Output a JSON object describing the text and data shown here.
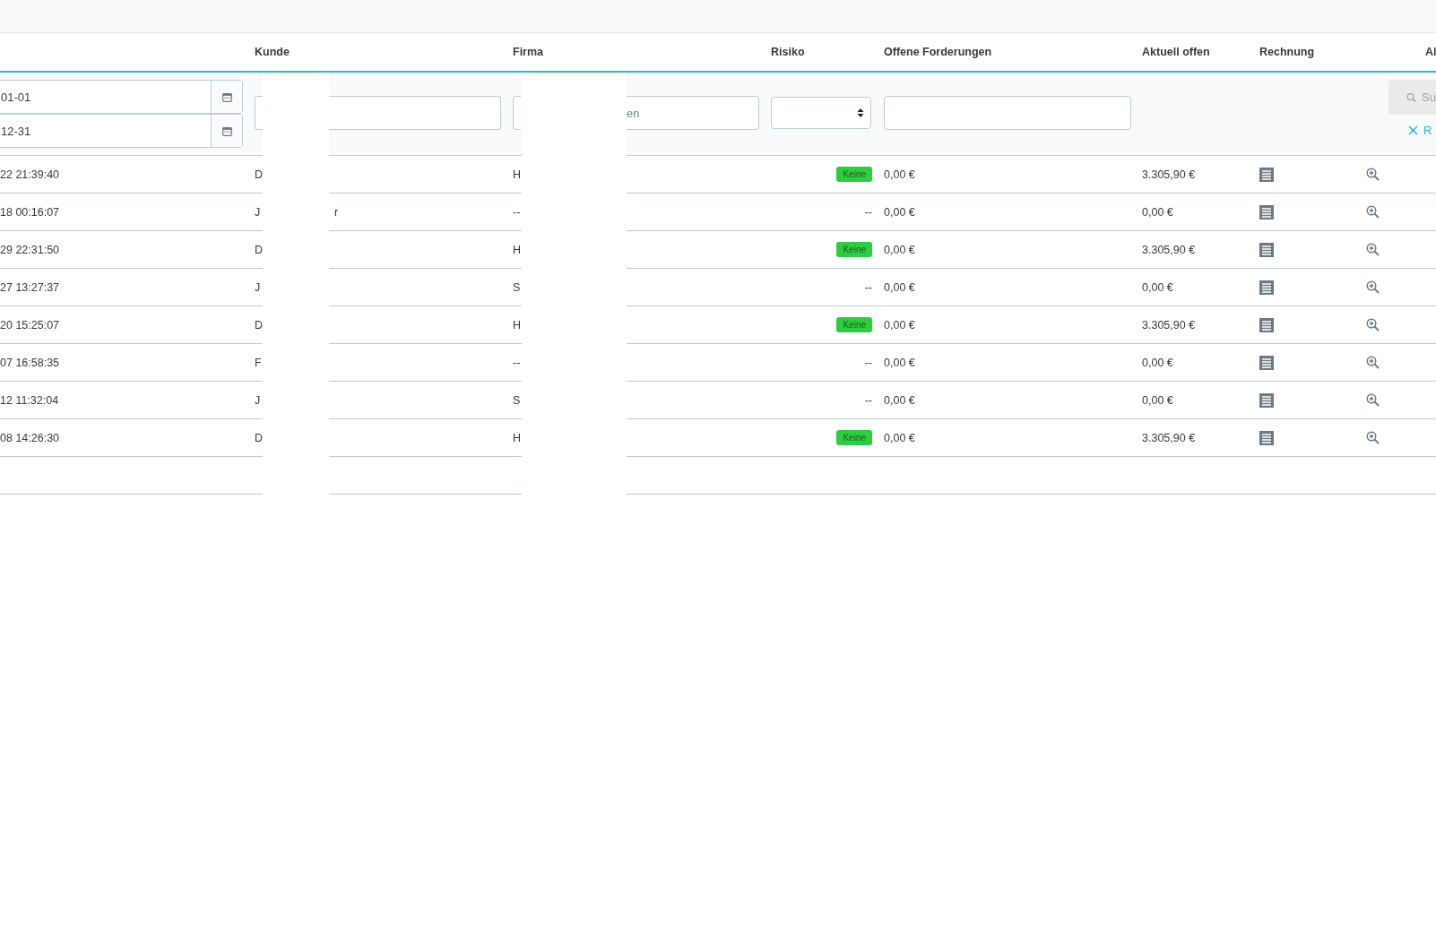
{
  "table": {
    "columns": [
      "",
      "Kunde",
      "Firma",
      "Risiko",
      "Offene Forderungen",
      "Aktuell offen",
      "Rechnung",
      "",
      "Al"
    ],
    "filters": {
      "date_from": "01-01",
      "date_to": "12-31",
      "firma_placeholder": "en",
      "search_button": "Su",
      "reset_link": "R"
    },
    "rows": [
      {
        "date": "22 21:39:40",
        "kunde": "D",
        "kunde_end": "",
        "firma": "H",
        "risk": {
          "kind": "badge",
          "text": "Keine"
        },
        "offen": "0,00 €",
        "aktuell": "3.305,90 €"
      },
      {
        "date": "18 00:16:07",
        "kunde": "J",
        "kunde_end": "r",
        "firma": "--",
        "risk": {
          "kind": "text",
          "text": "--"
        },
        "offen": "0,00 €",
        "aktuell": "0,00 €"
      },
      {
        "date": "29 22:31:50",
        "kunde": "D",
        "kunde_end": "",
        "firma": "H",
        "risk": {
          "kind": "badge",
          "text": "Keine"
        },
        "offen": "0,00 €",
        "aktuell": "3.305,90 €"
      },
      {
        "date": "27 13:27:37",
        "kunde": "J",
        "kunde_end": "",
        "firma": "S",
        "risk": {
          "kind": "text",
          "text": "--"
        },
        "offen": "0,00 €",
        "aktuell": "0,00 €"
      },
      {
        "date": "20 15:25:07",
        "kunde": "D",
        "kunde_end": "",
        "firma": "H",
        "risk": {
          "kind": "badge",
          "text": "Keine"
        },
        "offen": "0,00 €",
        "aktuell": "3.305,90 €"
      },
      {
        "date": "07 16:58:35",
        "kunde": "F",
        "kunde_end": "",
        "firma": "--",
        "risk": {
          "kind": "text",
          "text": "--"
        },
        "offen": "0,00 €",
        "aktuell": "0,00 €"
      },
      {
        "date": "12 11:32:04",
        "kunde": "J",
        "kunde_end": "",
        "firma": "S",
        "risk": {
          "kind": "text",
          "text": "--"
        },
        "offen": "0,00 €",
        "aktuell": "0,00 €"
      },
      {
        "date": "08 14:26:30",
        "kunde": "D",
        "kunde_end": "",
        "firma": "H",
        "risk": {
          "kind": "badge",
          "text": "Keine"
        },
        "offen": "0,00 €",
        "aktuell": "3.305,90 €"
      }
    ]
  }
}
